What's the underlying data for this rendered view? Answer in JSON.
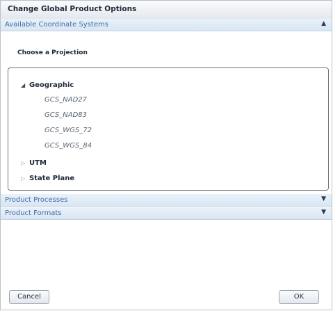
{
  "dialog": {
    "title": "Change Global Product Options"
  },
  "sections": {
    "coordinate_systems": {
      "label": "Available Coordinate Systems",
      "chevron": "chevron-up-icon",
      "expanded": true
    },
    "processes": {
      "label": "Product Processes",
      "chevron": "chevron-down-icon",
      "expanded": false
    },
    "formats": {
      "label": "Product Formats",
      "chevron": "chevron-down-icon",
      "expanded": false
    }
  },
  "projection": {
    "prompt": "Choose a Projection",
    "tree": {
      "geographic": {
        "label": "Geographic",
        "expanded": true,
        "children": [
          "GCS_NAD27",
          "GCS_NAD83",
          "GCS_WGS_72",
          "GCS_WGS_84"
        ]
      },
      "utm": {
        "label": "UTM",
        "expanded": false
      },
      "state_plane": {
        "label": "State Plane",
        "expanded": false
      }
    }
  },
  "buttons": {
    "cancel": "Cancel",
    "ok": "OK"
  }
}
